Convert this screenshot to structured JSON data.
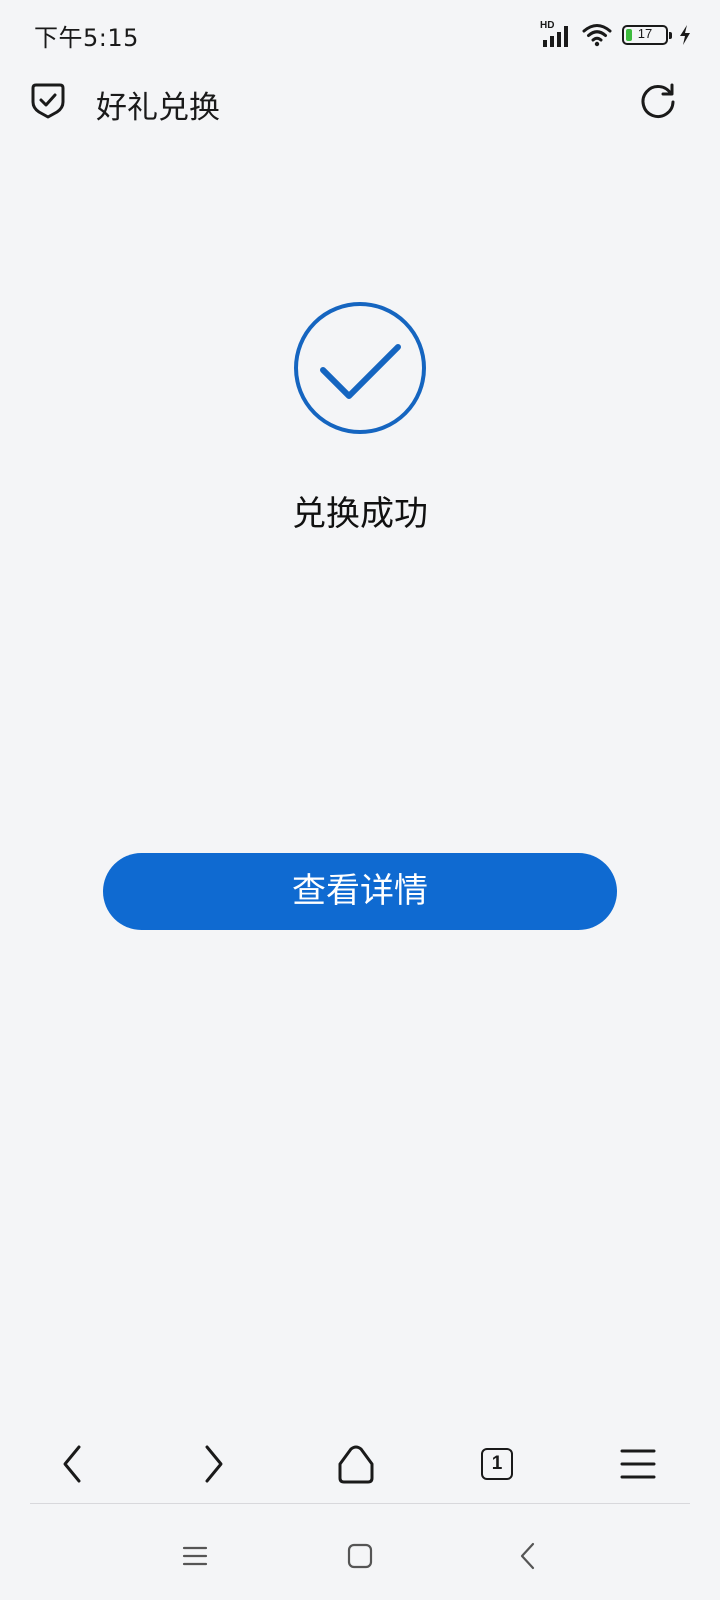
{
  "status_bar": {
    "time": "下午5:15",
    "network_label": "HD",
    "battery_level": "17",
    "battery_fraction": 0.17,
    "icons": [
      "hd-signal-icon",
      "wifi-icon",
      "battery-icon",
      "charging-icon"
    ]
  },
  "header": {
    "title": "好礼兑换",
    "left_icon": "shield-check-icon",
    "right_icon": "refresh-icon"
  },
  "result": {
    "icon": "success-check-icon",
    "message": "兑换成功"
  },
  "actions": {
    "details_label": "查看详情"
  },
  "browser_toolbar": {
    "tab_count": "1",
    "items": [
      "back-icon",
      "forward-icon",
      "home-icon",
      "tabs-icon",
      "menu-icon"
    ]
  },
  "system_nav": {
    "items": [
      "recents-icon",
      "home-icon",
      "back-icon"
    ]
  },
  "colors": {
    "background": "#f4f5f7",
    "accent": "#0f6ad1",
    "success": "#1565c0",
    "battery": "#3dbb3d"
  }
}
